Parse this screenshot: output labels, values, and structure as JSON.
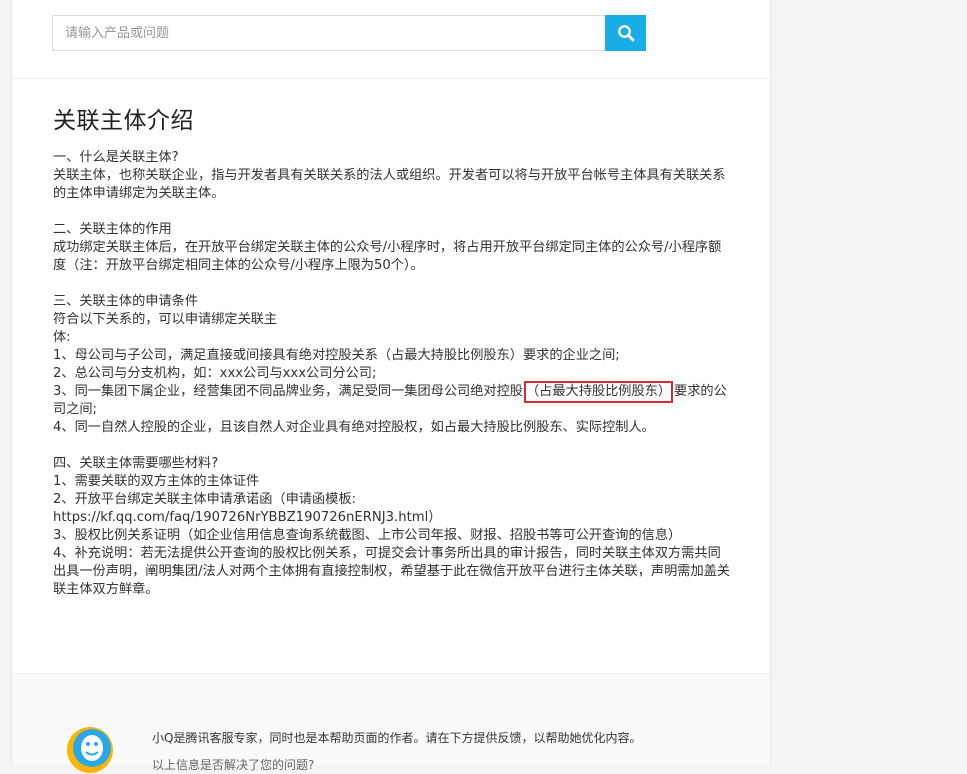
{
  "search": {
    "placeholder": "请输入产品或问题",
    "icon": "search-icon",
    "button_color": "#1aade5"
  },
  "article": {
    "title": "关联主体介绍",
    "s1": {
      "heading": "一、什么是关联主体?",
      "body": "关联主体，也称关联企业，指与开发者具有关联关系的法人或组织。开发者可以将与开放平台帐号主体具有关联关系的主体申请绑定为关联主体。"
    },
    "s2": {
      "heading": "二、关联主体的作用",
      "body": "成功绑定关联主体后，在开放平台绑定关联主体的公众号/小程序时，将占用开放平台绑定同主体的公众号/小程序额度（注：开放平台绑定相同主体的公众号/小程序上限为50个）。"
    },
    "s3": {
      "heading": "三、关联主体的申请条件",
      "intro_a": "符合以下关系的，可以申请绑定关联主",
      "intro_b": "体:",
      "item1": "1、母公司与子公司，满足直接或间接具有绝对控股关系（占最大持股比例股东）要求的企业之间;",
      "item2": "2、总公司与分支机构，如：xxx公司与xxx公司分公司;",
      "item3_pre": "3、同一集团下属企业，经营集团不同品牌业务，满足受同一集团母公司绝对控股",
      "item3_highlight": "（占最大持股比例股东）",
      "item3_post": "要求的公司之间;",
      "item4": "4、同一自然人控股的企业，且该自然人对企业具有绝对控股权，如占最大持股比例股东、实际控制人。"
    },
    "s4": {
      "heading": "四、关联主体需要哪些材料?",
      "item1": "1、需要关联的双方主体的主体证件",
      "item2": "2、开放平台绑定关联主体申请承诺函（申请函模板:",
      "item2_url": "https://kf.qq.com/faq/190726NrYBBZ190726nERNJ3.html）",
      "item3": "3、股权比例关系证明（如企业信用信息查询系统截图、上市公司年报、财报、招股书等可公开查询的信息）",
      "item4": "4、补充说明：若无法提供公开查询的股权比例关系，可提交会计事务所出具的审计报告，同时关联主体双方需共同出具一份声明，阐明集团/法人对两个主体拥有直接控制权，希望基于此在微信开放平台进行主体关联，声明需加盖关联主体双方鲜章。"
    },
    "highlight_color": "#d0312d"
  },
  "footer": {
    "avatar_icon": "qq-penguin-avatar-icon",
    "intro": "小Q是腾讯客服专家，同时也是本帮助页面的作者。请在下方提供反馈，以帮助她优化内容。",
    "question": "以上信息是否解决了您的问题?"
  }
}
